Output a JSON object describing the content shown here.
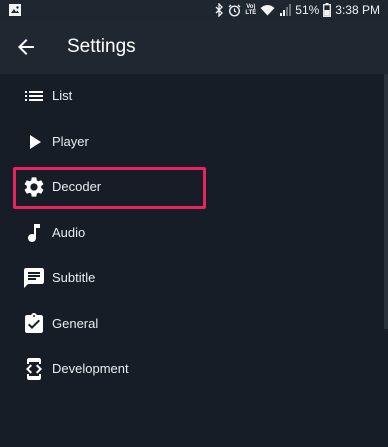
{
  "status_bar": {
    "battery_percent": "51%",
    "time": "3:38 PM",
    "volte_label": "Vo)",
    "lte_label": "LTE",
    "icons": [
      "image-icon",
      "bluetooth-icon",
      "alarm-icon",
      "volte-icon",
      "wifi-icon",
      "signal-icon",
      "battery-icon"
    ]
  },
  "app_bar": {
    "title": "Settings",
    "back_icon": "arrow-back-icon"
  },
  "menu": {
    "items": [
      {
        "label": "List",
        "icon": "list-icon"
      },
      {
        "label": "Player",
        "icon": "play-icon"
      },
      {
        "label": "Decoder",
        "icon": "gear-icon",
        "highlighted": true
      },
      {
        "label": "Audio",
        "icon": "music-note-icon"
      },
      {
        "label": "Subtitle",
        "icon": "subtitle-icon"
      },
      {
        "label": "General",
        "icon": "clipboard-check-icon"
      },
      {
        "label": "Development",
        "icon": "developer-mode-icon"
      }
    ]
  },
  "colors": {
    "background": "#161d26",
    "app_bar": "#1f2731",
    "highlight": "#e8245e",
    "text": "#e9edf1"
  }
}
